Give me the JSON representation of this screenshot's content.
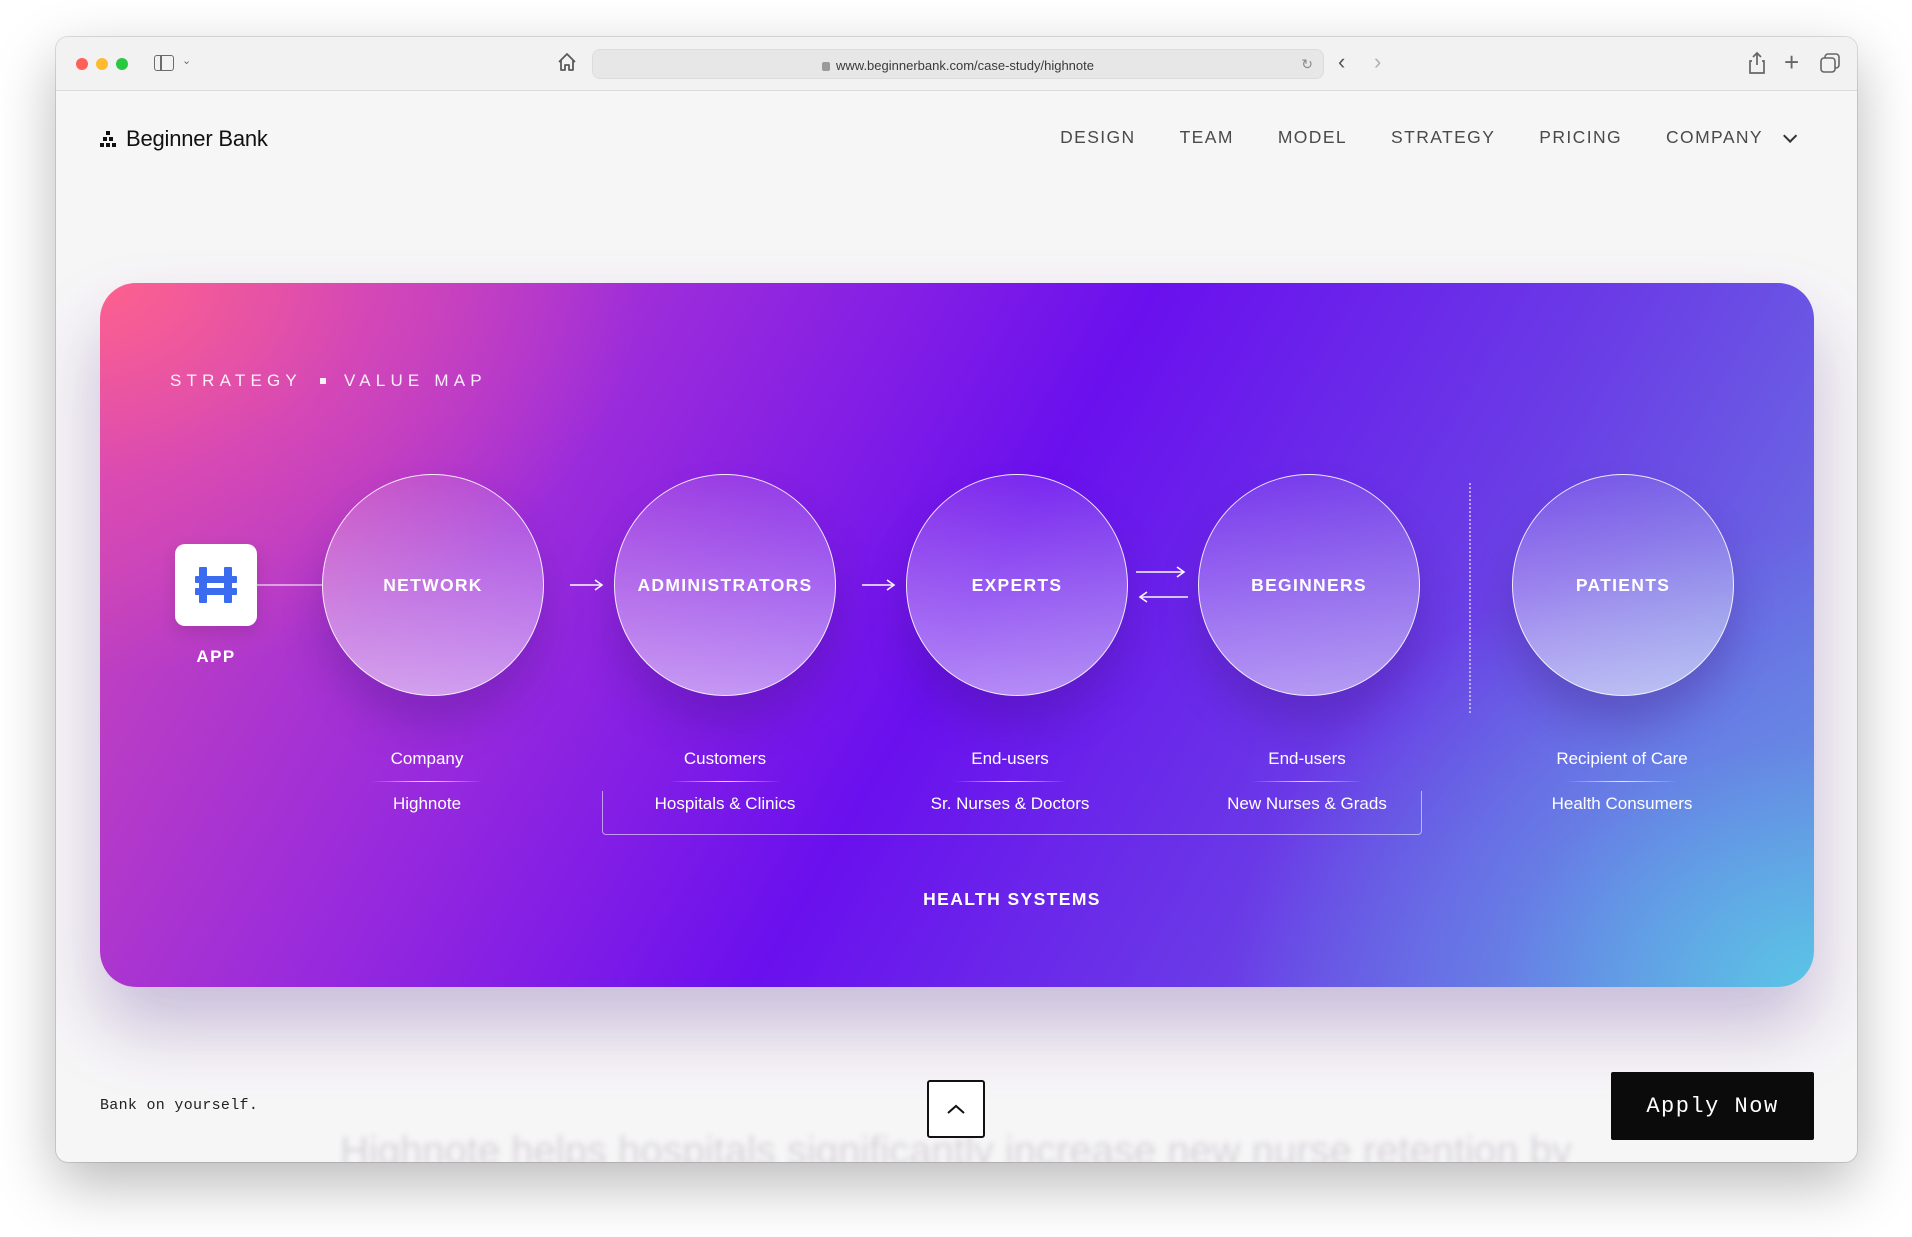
{
  "browser": {
    "url": "www.beginnerbank.com/case-study/highnote"
  },
  "site": {
    "logo_text": "Beginner Bank",
    "nav": [
      {
        "label": "DESIGN"
      },
      {
        "label": "TEAM"
      },
      {
        "label": "MODEL"
      },
      {
        "label": "STRATEGY"
      },
      {
        "label": "PRICING"
      },
      {
        "label": "COMPANY"
      }
    ]
  },
  "value_map": {
    "eyebrow_left": "STRATEGY",
    "eyebrow_right": "VALUE MAP",
    "app_label": "APP",
    "nodes": [
      {
        "label": "NETWORK",
        "top": "Company",
        "bottom": "Highnote"
      },
      {
        "label": "ADMINISTRATORS",
        "top": "Customers",
        "bottom": "Hospitals & Clinics"
      },
      {
        "label": "EXPERTS",
        "top": "End-users",
        "bottom": "Sr. Nurses & Doctors"
      },
      {
        "label": "BEGINNERS",
        "top": "End-users",
        "bottom": "New Nurses & Grads"
      },
      {
        "label": "PATIENTS",
        "top": "Recipient of Care",
        "bottom": "Health Consumers"
      }
    ],
    "group_label": "HEALTH SYSTEMS"
  },
  "footer": {
    "tagline": "Bank on yourself.",
    "apply_label": "Apply Now",
    "ghost_text": "Highnote helps hospitals significantly increase new nurse retention by"
  },
  "colors": {
    "app_icon_blue": "#3b6cf0",
    "button_black": "#0b0b0b"
  }
}
